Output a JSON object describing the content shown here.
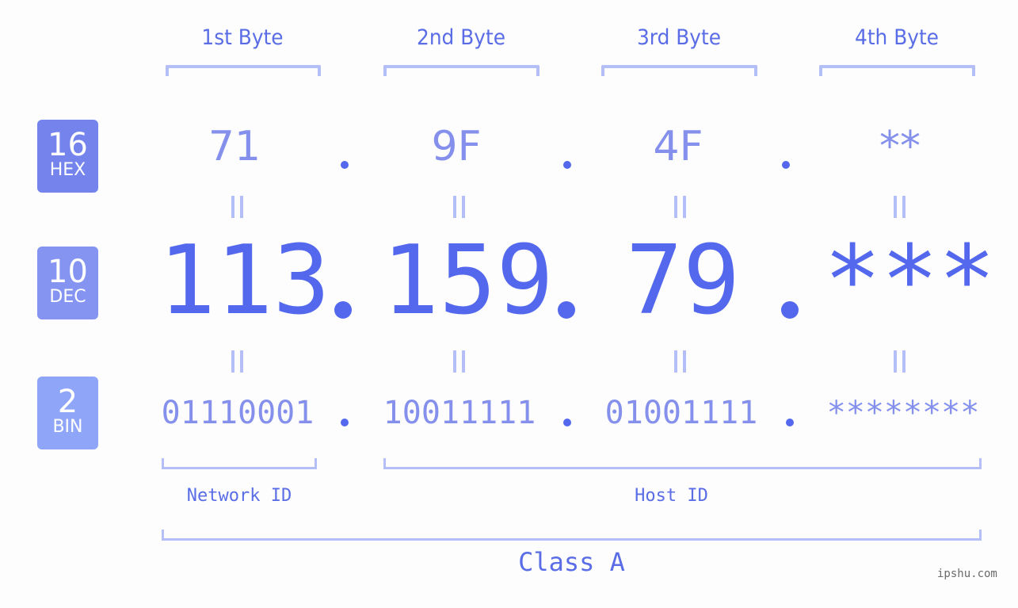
{
  "ip": {
    "hex": [
      "71",
      "9F",
      "4F",
      "**"
    ],
    "dec": [
      "113",
      "159",
      "79",
      "***"
    ],
    "bin": [
      "01110001",
      "10011111",
      "01001111",
      "********"
    ],
    "separator": "."
  },
  "byte_labels": [
    "1st Byte",
    "2nd Byte",
    "3rd Byte",
    "4th Byte"
  ],
  "badges": {
    "hex": {
      "num": "16",
      "name": "HEX",
      "color": "#7484ec"
    },
    "dec": {
      "num": "10",
      "name": "DEC",
      "color": "#8494f0"
    },
    "bin": {
      "num": "2",
      "name": "BIN",
      "color": "#8fa6f8"
    }
  },
  "segments": {
    "network_id": "Network ID",
    "host_id": "Host ID",
    "class": "Class A"
  },
  "watermark": "ipshu.com",
  "colors": {
    "accent": "#5468ee",
    "secondary": "#8490ec",
    "bracket": "#b4bef7",
    "label": "#5a6de6"
  }
}
